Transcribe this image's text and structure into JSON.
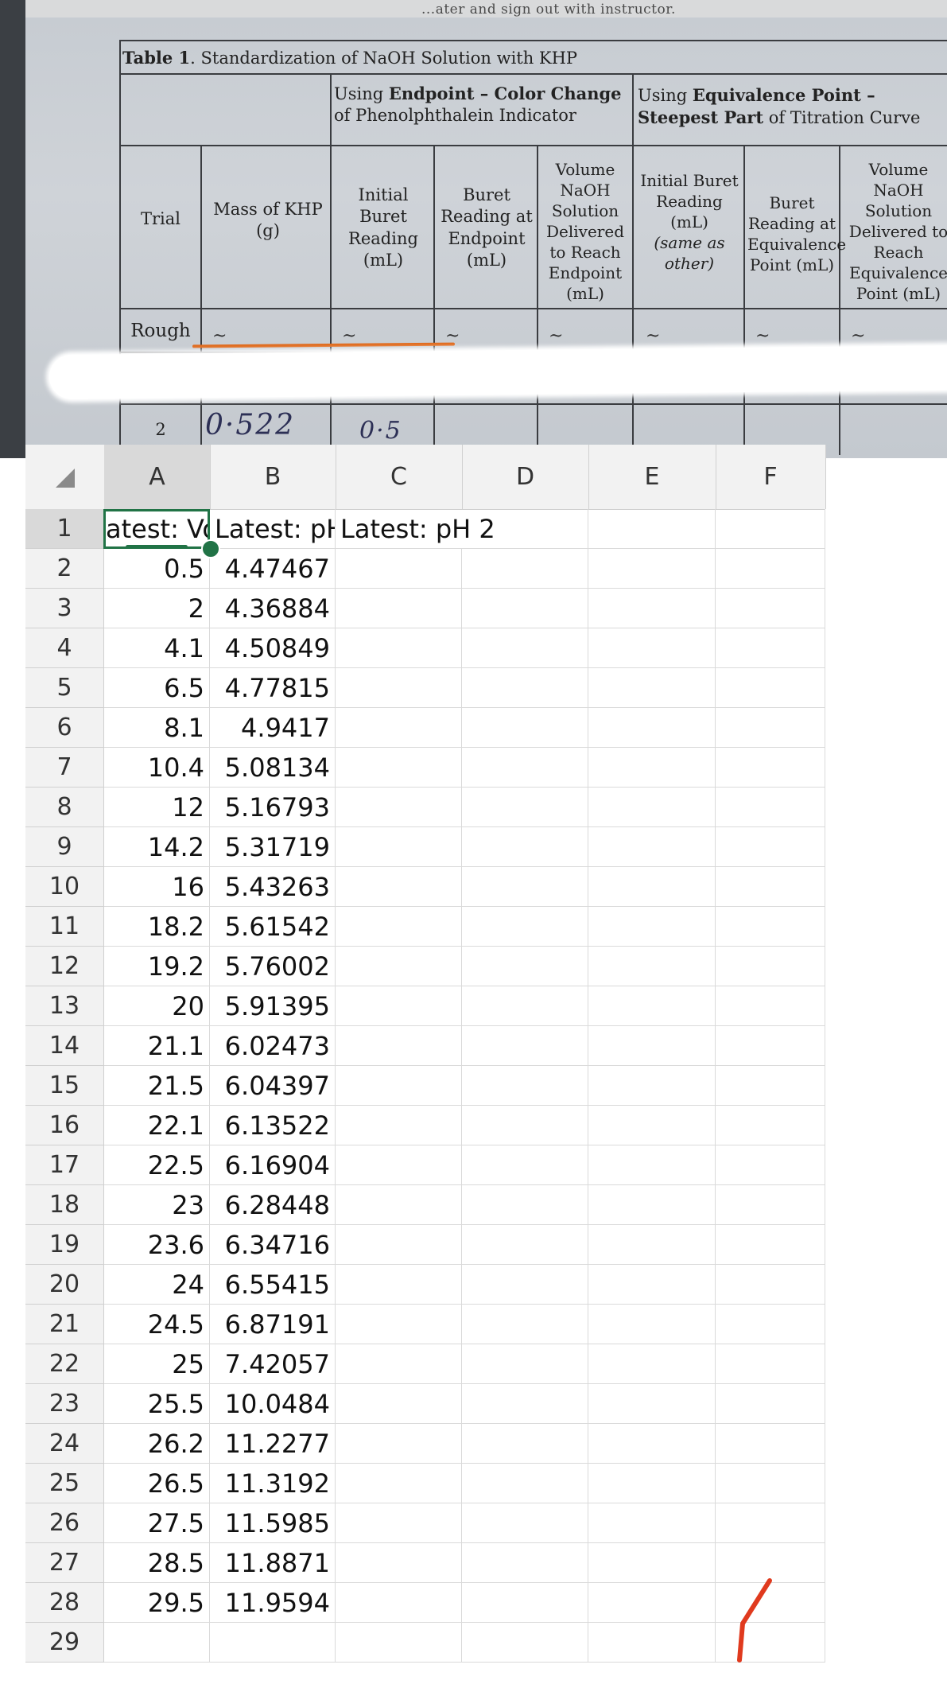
{
  "photo": {
    "top_text": "...ater and sign out with instructor.",
    "table_title_bold": "Table 1",
    "table_title_rest": ". Standardization of NaOH Solution with KHP",
    "group_endpoint_pre": "Using ",
    "group_endpoint_bold": "Endpoint – Color Change",
    "group_endpoint_post": " of Phenolphthalein Indicator",
    "group_equiv_pre": "Using ",
    "group_equiv_bold": "Equivalence Point – Steepest Part",
    "group_equiv_post": " of Titration Curve",
    "col_headers": [
      "Trial",
      "Mass of KHP (g)",
      "Initial Buret Reading (mL)",
      "Buret Reading at Endpoint (mL)",
      "Volume NaOH Solution Delivered to Reach Endpoint (mL)",
      "Initial Buret Reading (mL)",
      "Buret Reading at Equivalence Point (mL)",
      "Volume NaOH Solution Delivered to Reach Equivalence Point (mL)"
    ],
    "col_header_italic_note": "(same as other)",
    "rows": [
      {
        "trial": "Rough",
        "cells": [
          "~",
          "~",
          "~",
          "~",
          "~",
          "~",
          "~"
        ]
      },
      {
        "trial": "2",
        "handwritten": [
          "0·522",
          "0·5"
        ]
      }
    ]
  },
  "spreadsheet": {
    "columns": [
      "A",
      "B",
      "C",
      "D",
      "E",
      "F"
    ],
    "selected_column": "A",
    "selected_row": 1,
    "header_row": {
      "A": "atest: Vo",
      "B": "Latest: pH",
      "C": "Latest: pH 2"
    },
    "data": [
      [
        "0.5",
        "4.47467"
      ],
      [
        "2",
        "4.36884"
      ],
      [
        "4.1",
        "4.50849"
      ],
      [
        "6.5",
        "4.77815"
      ],
      [
        "8.1",
        "4.9417"
      ],
      [
        "10.4",
        "5.08134"
      ],
      [
        "12",
        "5.16793"
      ],
      [
        "14.2",
        "5.31719"
      ],
      [
        "16",
        "5.43263"
      ],
      [
        "18.2",
        "5.61542"
      ],
      [
        "19.2",
        "5.76002"
      ],
      [
        "20",
        "5.91395"
      ],
      [
        "21.1",
        "6.02473"
      ],
      [
        "21.5",
        "6.04397"
      ],
      [
        "22.1",
        "6.13522"
      ],
      [
        "22.5",
        "6.16904"
      ],
      [
        "23",
        "6.28448"
      ],
      [
        "23.6",
        "6.34716"
      ],
      [
        "24",
        "6.55415"
      ],
      [
        "24.5",
        "6.87191"
      ],
      [
        "25",
        "7.42057"
      ],
      [
        "25.5",
        "10.0484"
      ],
      [
        "26.2",
        "11.2277"
      ],
      [
        "26.5",
        "11.3192"
      ],
      [
        "27.5",
        "11.5985"
      ],
      [
        "28.5",
        "11.8871"
      ],
      [
        "29.5",
        "11.9594"
      ]
    ],
    "row_count": 29,
    "colors": {
      "accent": "#217346",
      "annotation": "#e03a1e"
    }
  }
}
